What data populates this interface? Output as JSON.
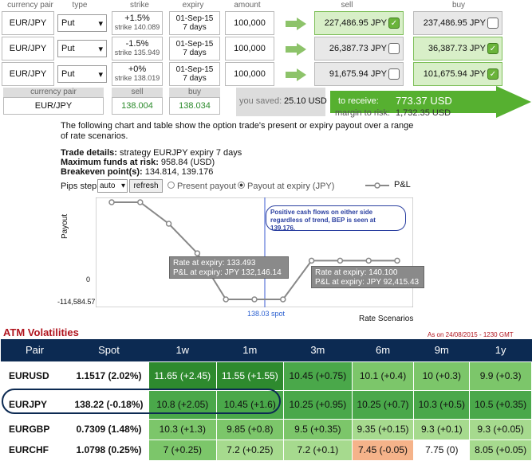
{
  "headers": {
    "pair": "currency pair",
    "type": "type",
    "strike": "strike",
    "expiry": "expiry",
    "amount": "amount",
    "sell": "sell",
    "buy": "buy"
  },
  "rows": [
    {
      "pair": "EUR/JPY",
      "type": "Put",
      "strike_pct": "+1.5%",
      "strike_val": "strike 140.089",
      "expiry_date": "01-Sep-15",
      "expiry_days": "7 days",
      "amount": "100,000",
      "sell": "227,486.95 JPY",
      "buy": "237,486.95 JPY"
    },
    {
      "pair": "EUR/JPY",
      "type": "Put",
      "strike_pct": "-1.5%",
      "strike_val": "strike 135.949",
      "expiry_date": "01-Sep-15",
      "expiry_days": "7 days",
      "amount": "100,000",
      "sell": "26,387.73 JPY",
      "buy": "36,387.73 JPY"
    },
    {
      "pair": "EUR/JPY",
      "type": "Put",
      "strike_pct": "+0%",
      "strike_val": "strike 138.019",
      "expiry_date": "01-Sep-15",
      "expiry_days": "7 days",
      "amount": "100,000",
      "sell": "91,675.94 JPY",
      "buy": "101,675.94 JPY"
    }
  ],
  "summary": {
    "pair_label": "currency pair",
    "sell_label": "sell",
    "buy_label": "buy",
    "pair": "EUR/JPY",
    "sell": "138.004",
    "buy": "138.034",
    "saved_label": "you saved:",
    "saved": "25.10 USD",
    "receive_label": "to receive:",
    "receive": "773.37 USD",
    "margin_label": "margin to risk:",
    "margin": "1,732.35 USD"
  },
  "desc": {
    "line1": "The following chart and table show the option trade's present or expiry payout over a range",
    "line2": "of rate scenarios.",
    "details_label": "Trade details:",
    "details": " strategy EURJPY expiry 7 days",
    "maxfunds_label": "Maximum funds at risk:",
    "maxfunds": " 958.84 (USD)",
    "breakeven_label": "Breakeven point(s):",
    "breakeven": " 134.814, 139.176"
  },
  "controls": {
    "pips_label": "Pips step:",
    "pips_value": "auto",
    "refresh": "refresh",
    "present": "Present payout",
    "expiry": "Payout at expiry (JPY)",
    "legend": "P&L"
  },
  "chart_data": {
    "type": "line",
    "ylabel": "Payout",
    "xlabel": "Rate Scenarios",
    "yticks": [
      "0",
      "-114,584.57"
    ],
    "spot_label": "138.03 spot",
    "note": "Positive cash flows on either side regardless of trend, BEP is seen at 139.176.",
    "tooltip1": [
      "Rate at expiry: 133.493",
      "P&L at expiry: JPY 132,146.14"
    ],
    "tooltip2": [
      "Rate at expiry: 140.100",
      "P&L at expiry: JPY 92,415.43"
    ],
    "series": [
      {
        "values": [
          405000,
          405000,
          290000,
          132146,
          -114584,
          -114584,
          -114584,
          92415,
          92415,
          92415,
          92415
        ]
      }
    ]
  },
  "vol": {
    "title": "ATM Volatilities",
    "asof": "As on 24/08/2015 - 1230 GMT",
    "columns": [
      "Pair",
      "Spot",
      "1w",
      "1m",
      "3m",
      "6m",
      "9m",
      "1y"
    ],
    "rows": [
      {
        "pair": "EURUSD",
        "spot": "1.1517 (2.02%)",
        "c": [
          "11.65 (+2.45)",
          "11.55 (+1.55)",
          "10.45 (+0.75)",
          "10.1 (+0.4)",
          "10 (+0.3)",
          "9.9 (+0.3)"
        ]
      },
      {
        "pair": "EURJPY",
        "spot": "138.22 (-0.18%)",
        "c": [
          "10.8 (+2.05)",
          "10.45 (+1.6)",
          "10.25 (+0.95)",
          "10.25 (+0.7)",
          "10.3 (+0.5)",
          "10.5 (+0.35)"
        ]
      },
      {
        "pair": "EURGBP",
        "spot": "0.7309 (1.48%)",
        "c": [
          "10.3 (+1.3)",
          "9.85 (+0.8)",
          "9.5 (+0.35)",
          "9.35 (+0.15)",
          "9.3 (+0.1)",
          "9.3 (+0.05)"
        ]
      },
      {
        "pair": "EURCHF",
        "spot": "1.0798 (0.25%)",
        "c": [
          "7 (+0.25)",
          "7.2 (+0.25)",
          "7.2 (+0.1)",
          "7.45 (-0.05)",
          "7.75 (0)",
          "8.05 (+0.05)"
        ]
      }
    ]
  }
}
